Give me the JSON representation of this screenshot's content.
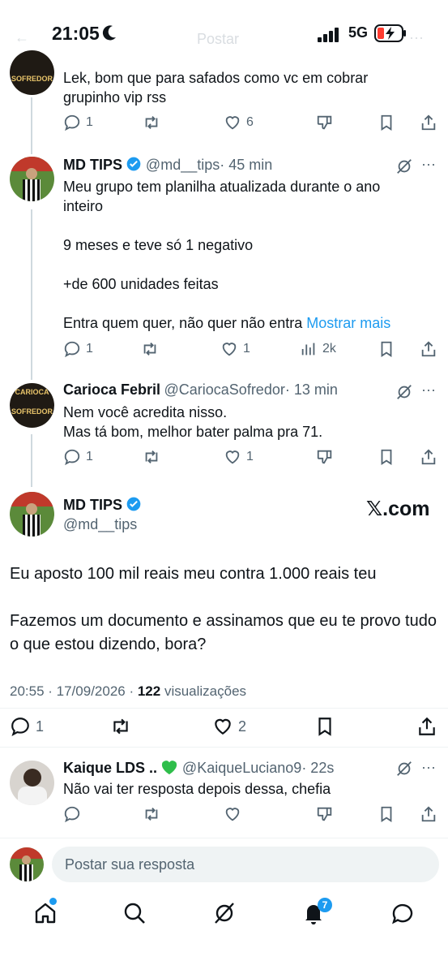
{
  "status_bar": {
    "time": "21:05",
    "network": "5G"
  },
  "header_ghost": {
    "back": "←",
    "title": "Postar"
  },
  "tweets": [
    {
      "text": "Lek, bom que para safados como vc em cobrar grupinho vip rss",
      "avatar_text": "SOFREDOR",
      "replies": "1",
      "likes": "6"
    },
    {
      "name": "MD TIPS",
      "handle": "@md__tips",
      "time": "· 45 min",
      "lines": [
        "Meu grupo tem planilha atualizada durante o ano inteiro",
        "9 meses e teve só 1 negativo",
        "+de 600 unidades feitas",
        "Entra quem quer, não quer não entra"
      ],
      "more": "Mostrar mais",
      "replies": "1",
      "likes": "1",
      "views": "2k"
    },
    {
      "name": "Carioca Febril",
      "handle": "@CariocaSofredor",
      "time": "· 13 min",
      "avatar_top": "CARIOCA",
      "avatar_bottom": "SOFREDOR",
      "lines": [
        "Nem você acredita nisso.",
        "Mas tá bom, melhor bater palma pra 71."
      ],
      "replies": "1",
      "likes": "1"
    }
  ],
  "main_tweet": {
    "name": "MD TIPS",
    "handle": "@md__tips",
    "xcom": ".com",
    "paragraph1": "Eu aposto 100 mil reais meu contra 1.000 reais teu",
    "paragraph2": "Fazemos um documento e assinamos que eu te provo tudo o que estou dizendo, bora?",
    "meta_date": "20:55 · 17/09/2026 · ",
    "views_count": "122",
    "views_label": " visualizações",
    "replies": "1",
    "likes": "2"
  },
  "reply": {
    "name": "Kaique LDS ..",
    "handle": "@KaiqueLuciano9",
    "time": "· 22s",
    "text": "Não vai ter resposta depois dessa, chefia"
  },
  "composer": {
    "placeholder": "Postar sua resposta"
  },
  "tabbar": {
    "notifications_badge": "7"
  },
  "colors": {
    "accent": "#1d9bf0",
    "verified": "#1d9bf0",
    "heart_badge": "#2fbe4b"
  }
}
